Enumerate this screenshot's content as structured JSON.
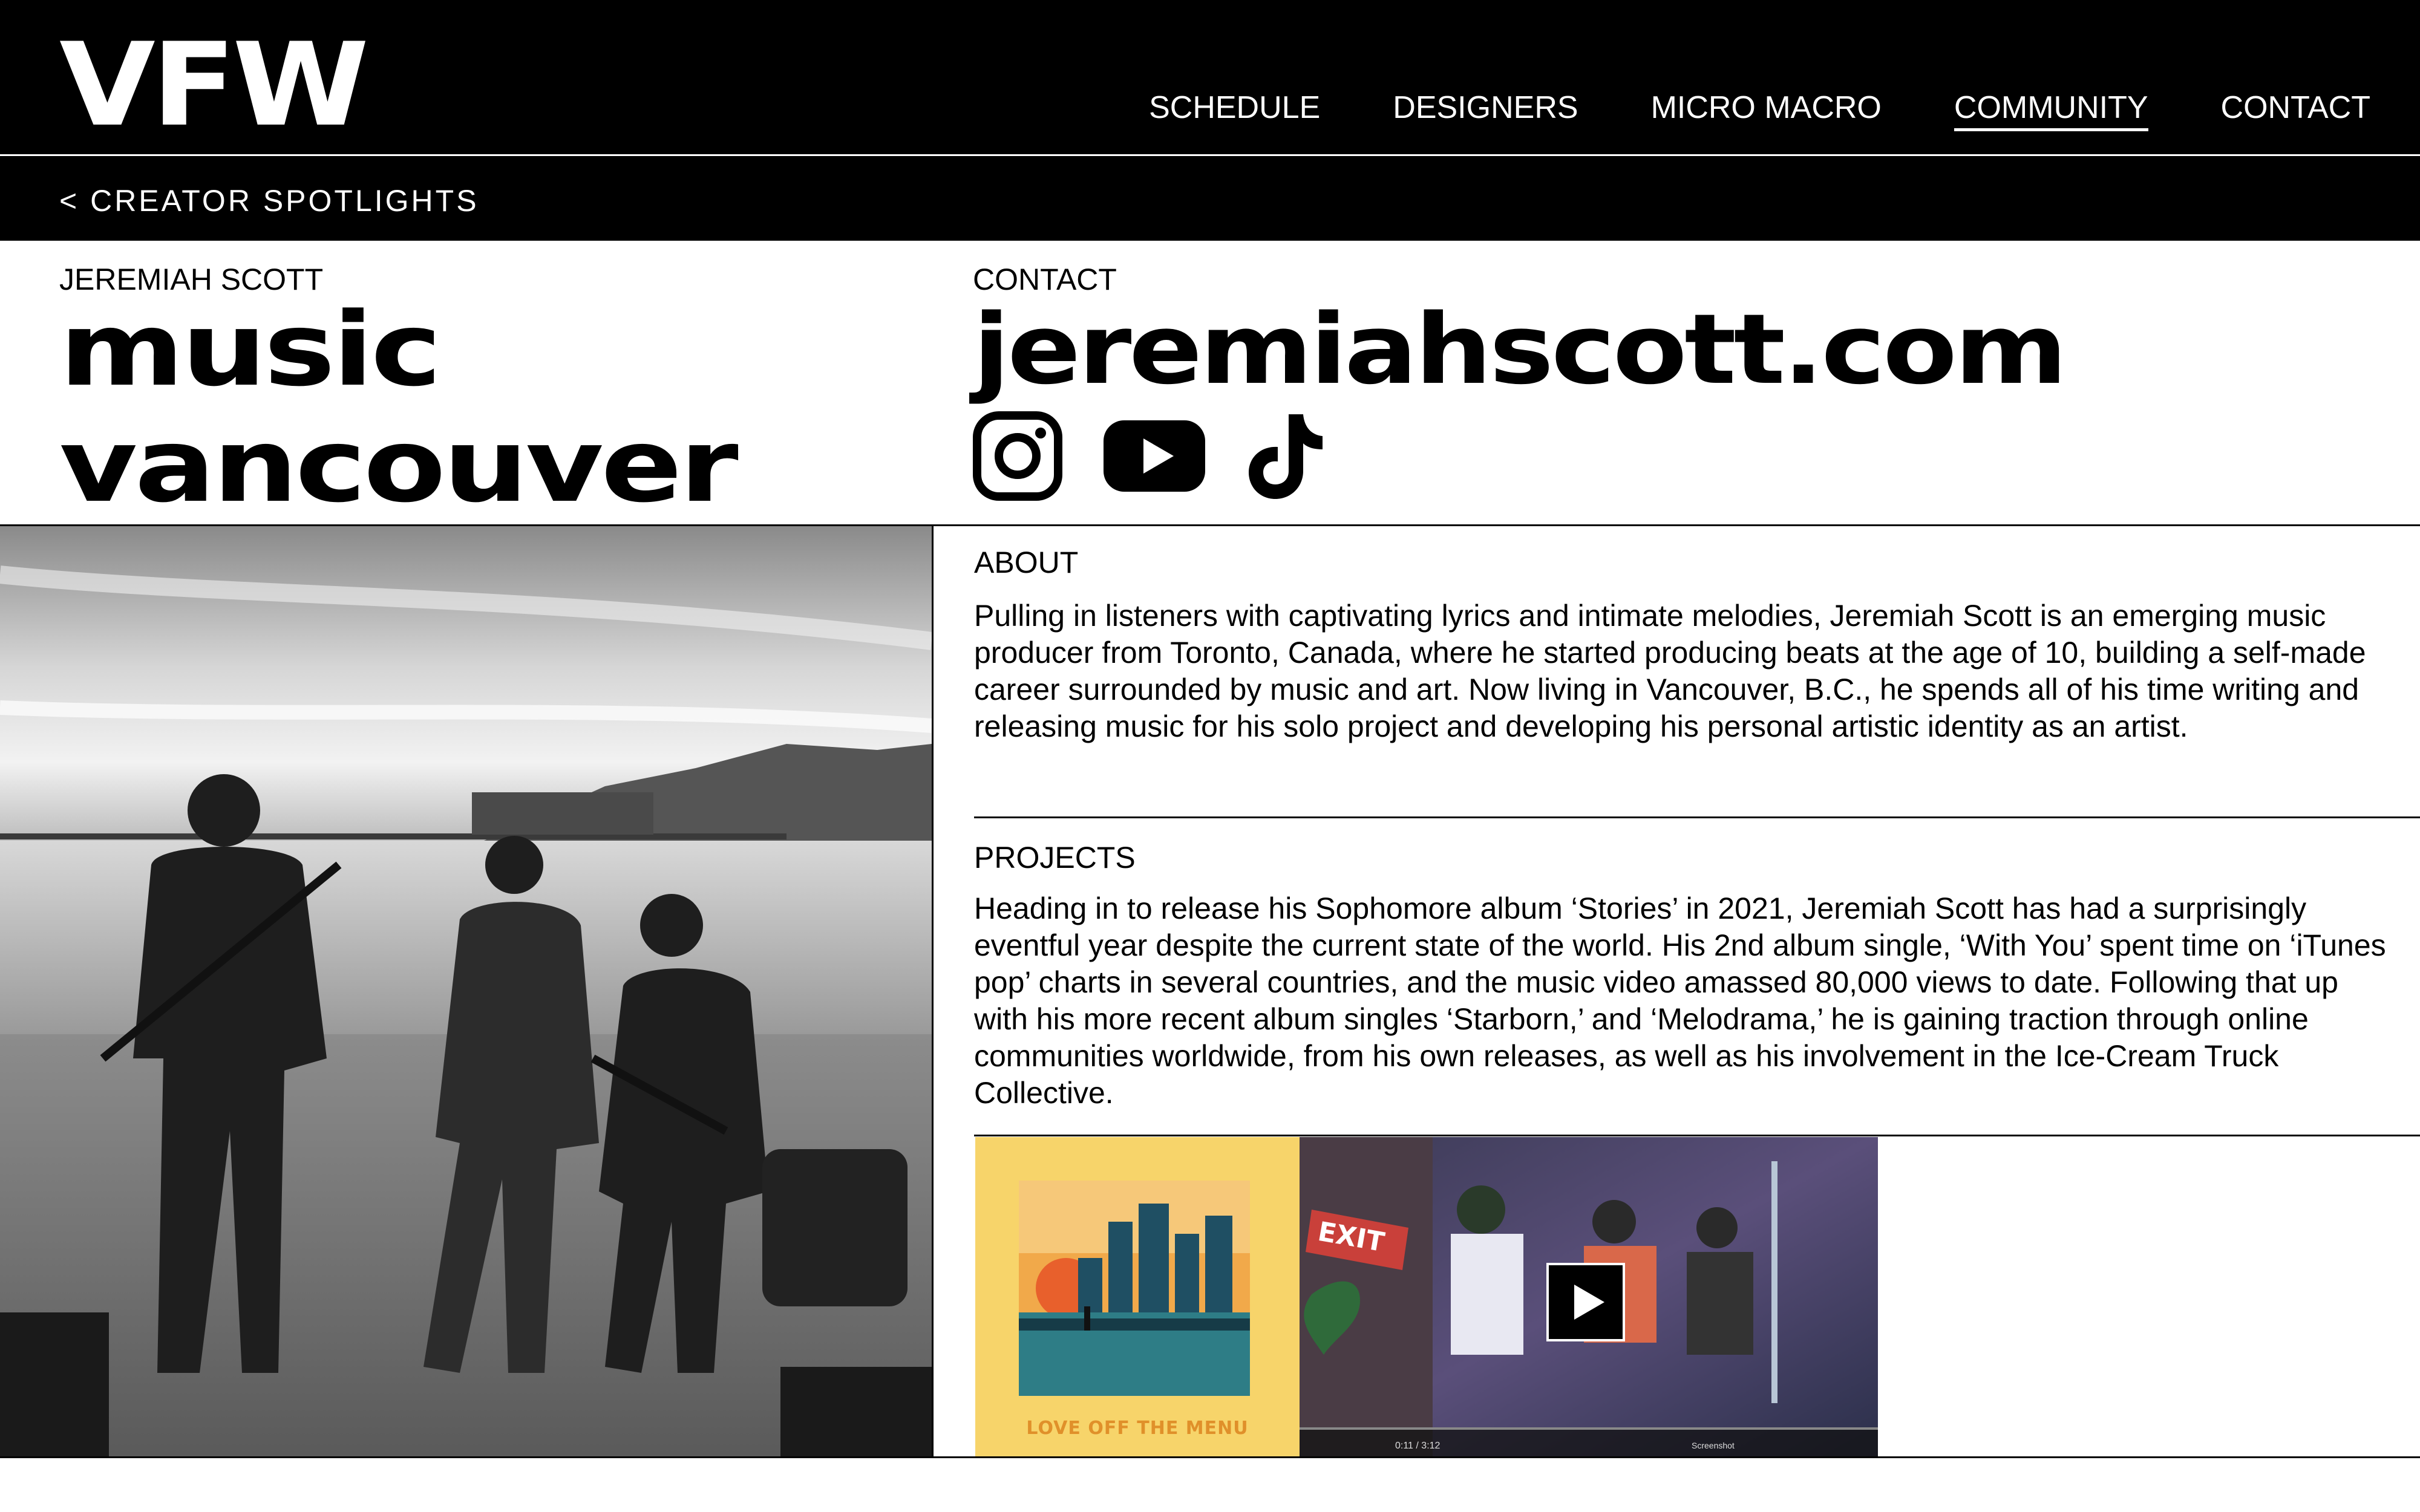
{
  "header": {
    "logo": "VFW",
    "nav": [
      {
        "label": "SCHEDULE",
        "active": false
      },
      {
        "label": "DESIGNERS",
        "active": false
      },
      {
        "label": "MICRO MACRO",
        "active": false
      },
      {
        "label": "COMMUNITY",
        "active": true
      },
      {
        "label": "CONTACT",
        "active": false
      }
    ],
    "back_link": "< CREATOR SPOTLIGHTS"
  },
  "profile": {
    "name": "JEREMIAH SCOTT",
    "discipline": "music",
    "city": "vancouver",
    "contact_label": "CONTACT",
    "website": "jeremiahscott.com",
    "social_icons": [
      "instagram-icon",
      "youtube-icon",
      "tiktok-icon"
    ]
  },
  "about": {
    "title": "ABOUT",
    "text": "Pulling in listeners with captivating lyrics and intimate melodies, Jeremiah Scott is an emerging music producer from Toronto, Canada, where he started producing beats at the age of 10, building a self-made career surrounded by music and art. Now living in Vancouver, B.C., he spends all of his time writing and releasing music for his solo project and developing his personal artistic identity as an artist."
  },
  "projects": {
    "title": "PROJECTS",
    "text": "Heading in to release his Sophomore album ‘Stories’ in 2021, Jeremiah Scott has had a surprisingly eventful year despite the current state of the world. His 2nd album single, ‘With You’ spent time on ‘iTunes pop’ charts in several countries, and the music video amassed 80,000 views to date. Following that up with his more recent album singles ‘Starborn,’ and ‘Melodrama,’ he is gaining traction through online communities worldwide, from his own releases, as well as his involvement in the Ice-Cream Truck Collective."
  },
  "media": {
    "album_title": "LOVE OFF THE MENU",
    "video_time": "0:11 / 3:12",
    "video_control_label": "Screenshot",
    "sign_text": "EXIT"
  },
  "colors": {
    "header_bg": "#000000",
    "album_bg": "#f7d46a"
  }
}
